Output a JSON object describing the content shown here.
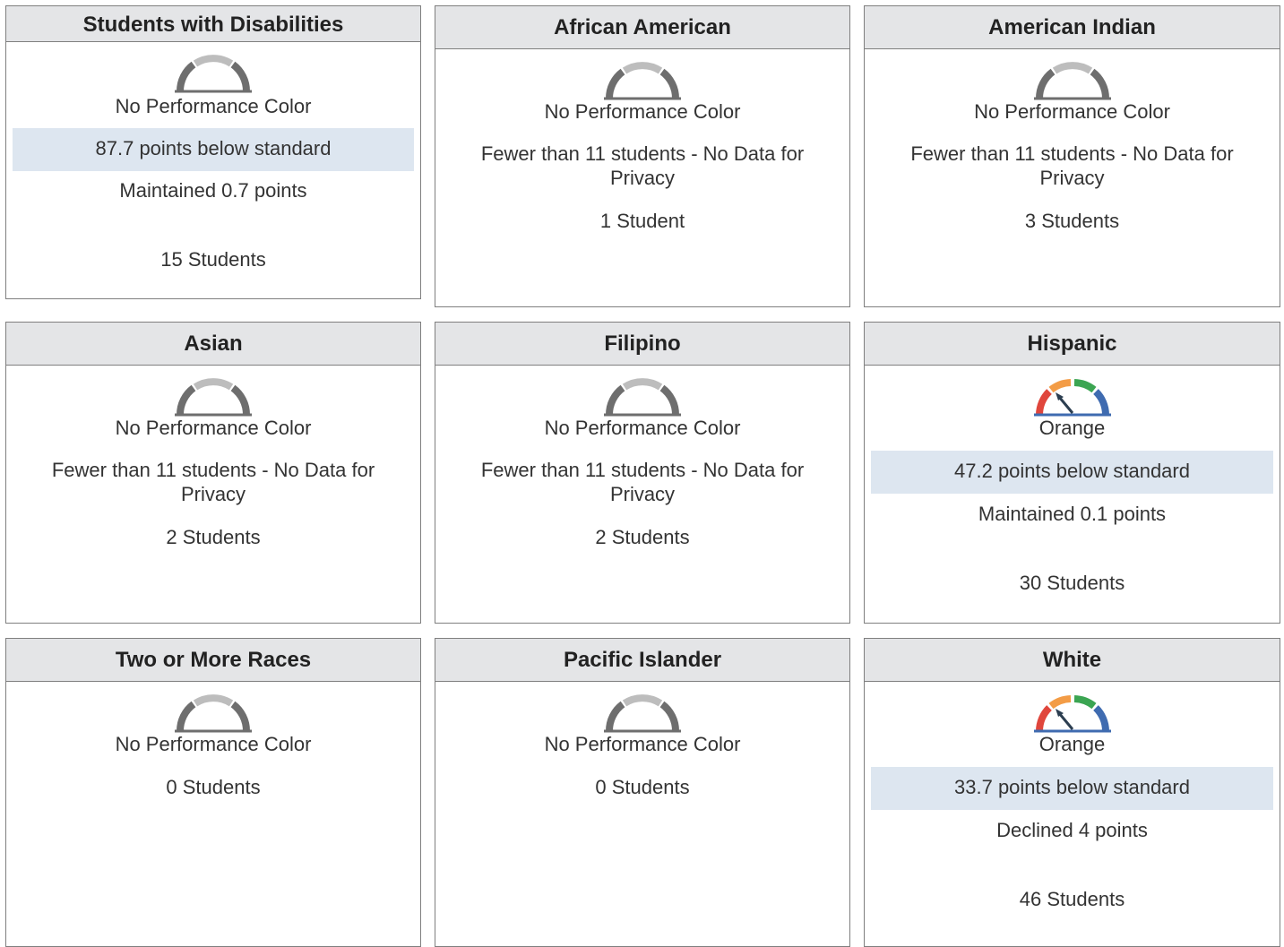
{
  "cards": [
    {
      "title": "Students with Disabilities",
      "color_label": "No Performance Color",
      "gauge": "grey-gauge-icon",
      "status": "87.7 points below standard",
      "change": "Maintained 0.7 points",
      "count": "15 Students"
    },
    {
      "title": "African American",
      "color_label": "No Performance Color",
      "gauge": "grey-gauge-icon",
      "privacy": "Fewer than 11 students - No Data for Privacy",
      "count": "1 Student"
    },
    {
      "title": "American Indian",
      "color_label": "No Performance Color",
      "gauge": "grey-gauge-icon",
      "privacy": "Fewer than 11 students - No Data for Privacy",
      "count": "3 Students"
    },
    {
      "title": "Asian",
      "color_label": "No Performance Color",
      "gauge": "grey-gauge-icon",
      "privacy": "Fewer than 11 students - No Data for Privacy",
      "count": "2 Students"
    },
    {
      "title": "Filipino",
      "color_label": "No Performance Color",
      "gauge": "grey-gauge-icon",
      "privacy": "Fewer than 11 students - No Data for Privacy",
      "count": "2 Students"
    },
    {
      "title": "Hispanic",
      "color_label": "Orange",
      "gauge": "orange-gauge-icon",
      "status": "47.2 points below standard",
      "change": "Maintained 0.1 points",
      "count": "30 Students"
    },
    {
      "title": "Two or More Races",
      "color_label": "No Performance Color",
      "gauge": "grey-gauge-icon",
      "count": "0 Students"
    },
    {
      "title": "Pacific Islander",
      "color_label": "No Performance Color",
      "gauge": "grey-gauge-icon",
      "count": "0 Students"
    },
    {
      "title": "White",
      "color_label": "Orange",
      "gauge": "orange-gauge-icon",
      "status": "33.7 points below standard",
      "change": "Declined 4 points",
      "count": "46 Students"
    }
  ],
  "colors": {
    "header_bg": "#e4e5e7",
    "status_band_bg": "#dde6f0",
    "gauge_grey_light": "#bdbdbd",
    "gauge_grey_dark": "#6e6e6e",
    "gauge_red": "#e0463c",
    "gauge_orange": "#f39c46",
    "gauge_yellow": "#f4cf4b",
    "gauge_green": "#3ba552",
    "gauge_blue": "#3f6bb0",
    "needle": "#2c3e50"
  }
}
